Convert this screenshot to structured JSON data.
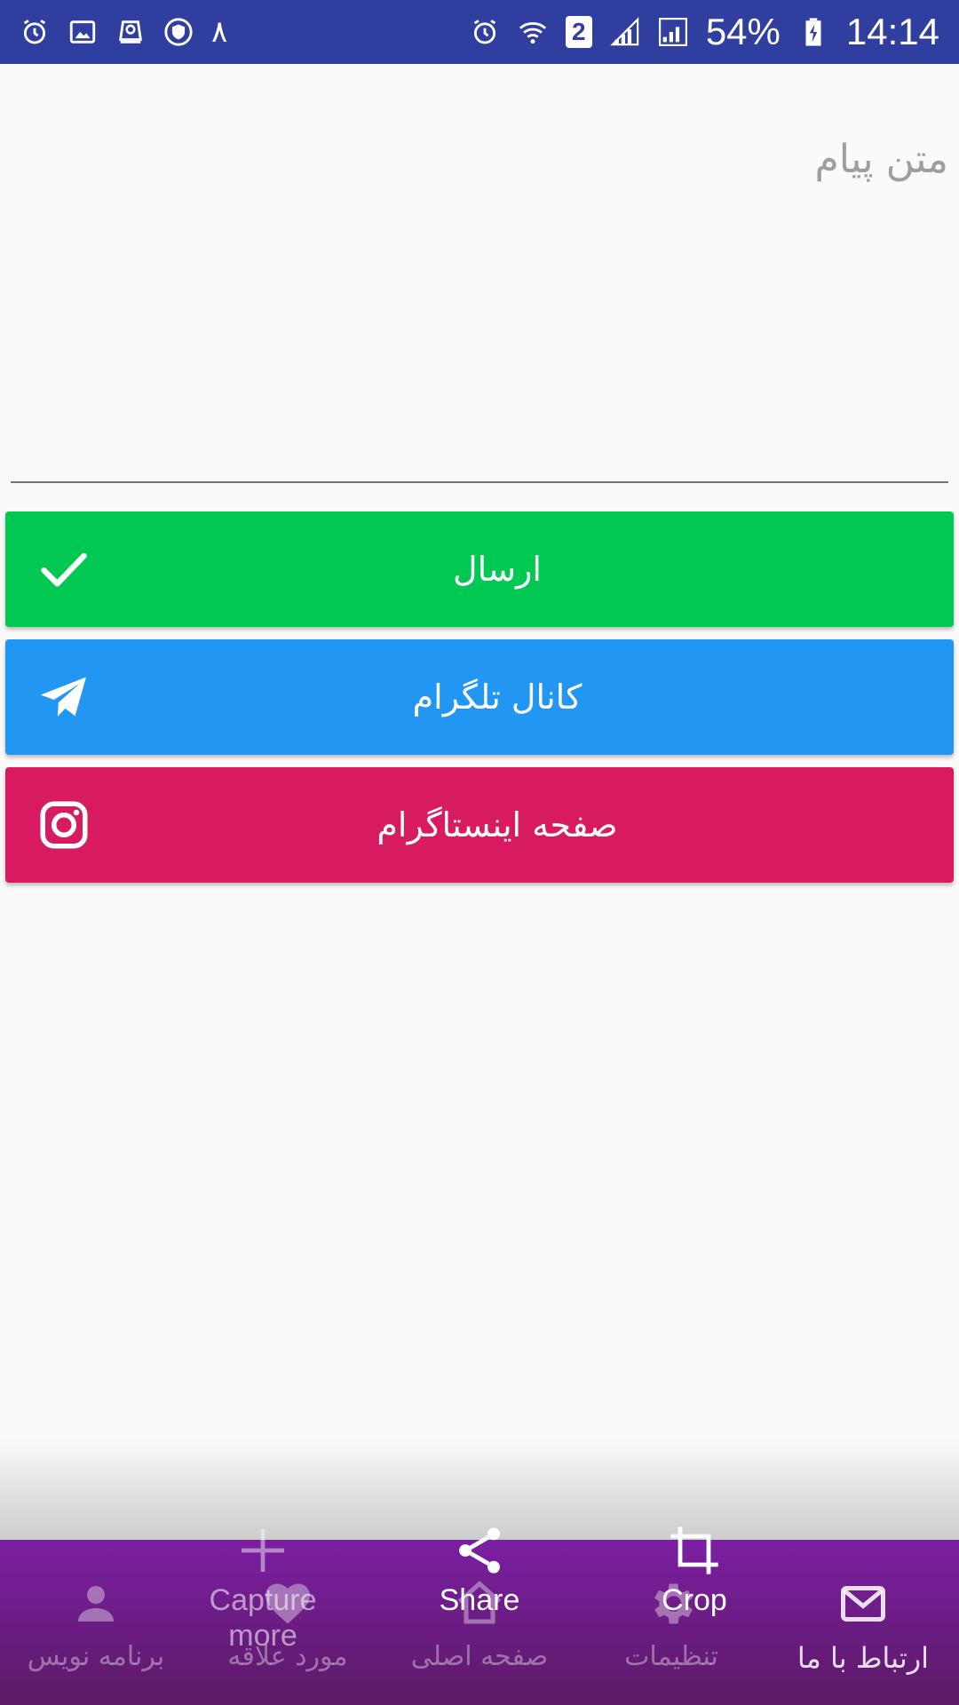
{
  "status_bar": {
    "left_icons": [
      "alarm-icon",
      "image-icon",
      "sync-drive-icon",
      "vpn-shield-icon"
    ],
    "left_digit": "۸",
    "right_icons": [
      "alarm-icon",
      "wifi-icon",
      "signal-icon",
      "signal-icon",
      "battery-charging-icon"
    ],
    "sim_number": "2",
    "battery": "54%",
    "time": "14:14"
  },
  "message": {
    "placeholder": "متن پیام"
  },
  "buttons": {
    "send": {
      "label": "ارسال",
      "icon": "check-icon",
      "color": "#00c853"
    },
    "telegram": {
      "label": "کانال تلگرام",
      "icon": "telegram-icon",
      "color": "#2196f3"
    },
    "instagram": {
      "label": "صفحه اینستاگرام",
      "icon": "instagram-icon",
      "color": "#d81b60"
    }
  },
  "bottom_nav": {
    "items": [
      {
        "label": "برنامه نویس",
        "icon": "person-icon"
      },
      {
        "label": "مورد علاقه",
        "icon": "heart-icon"
      },
      {
        "label": "صفحه اصلی",
        "icon": "home-icon"
      },
      {
        "label": "تنظیمات",
        "icon": "gear-icon"
      },
      {
        "label": "ارتباط با ما",
        "icon": "mail-icon"
      }
    ],
    "active_index": 4,
    "color": "#7b1fa2"
  },
  "screenshot_actions": {
    "capture": "Capture more",
    "share": "Share",
    "crop": "Crop"
  }
}
